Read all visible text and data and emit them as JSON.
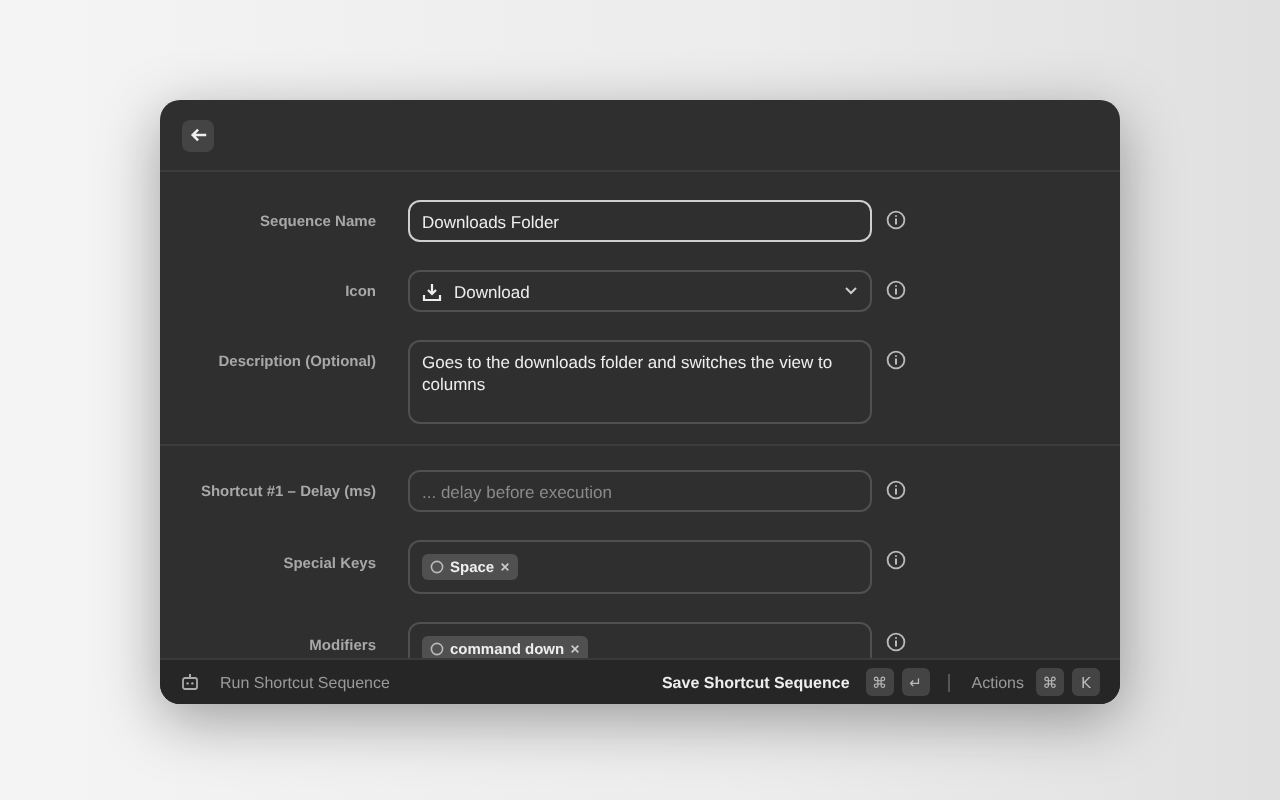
{
  "form": {
    "sections": [
      {
        "fields": [
          {
            "kind": "text",
            "label": "Sequence Name",
            "value": "Downloads Folder",
            "focused": true
          },
          {
            "kind": "select",
            "label": "Icon",
            "value": "Download",
            "focused": false
          },
          {
            "kind": "textarea",
            "label": "Description (Optional)",
            "value": "Goes to the downloads folder and switches the view to columns",
            "focused": false
          }
        ]
      },
      {
        "fields": [
          {
            "kind": "text",
            "label": "Shortcut #1 – Delay (ms)",
            "placeholder": "... delay before execution",
            "focused": false
          },
          {
            "kind": "tags",
            "label": "Special Keys",
            "tags": [
              "Space"
            ],
            "focused": false
          },
          {
            "kind": "tags",
            "label": "Modifiers",
            "tags": [
              "command down"
            ],
            "focused": false
          }
        ]
      }
    ]
  },
  "footer": {
    "title": "Run Shortcut Sequence",
    "primary_action": "Save Shortcut Sequence",
    "primary_keys": [
      "⌘",
      "↵"
    ],
    "actions_label": "Actions",
    "actions_keys": [
      "⌘",
      "K"
    ]
  }
}
